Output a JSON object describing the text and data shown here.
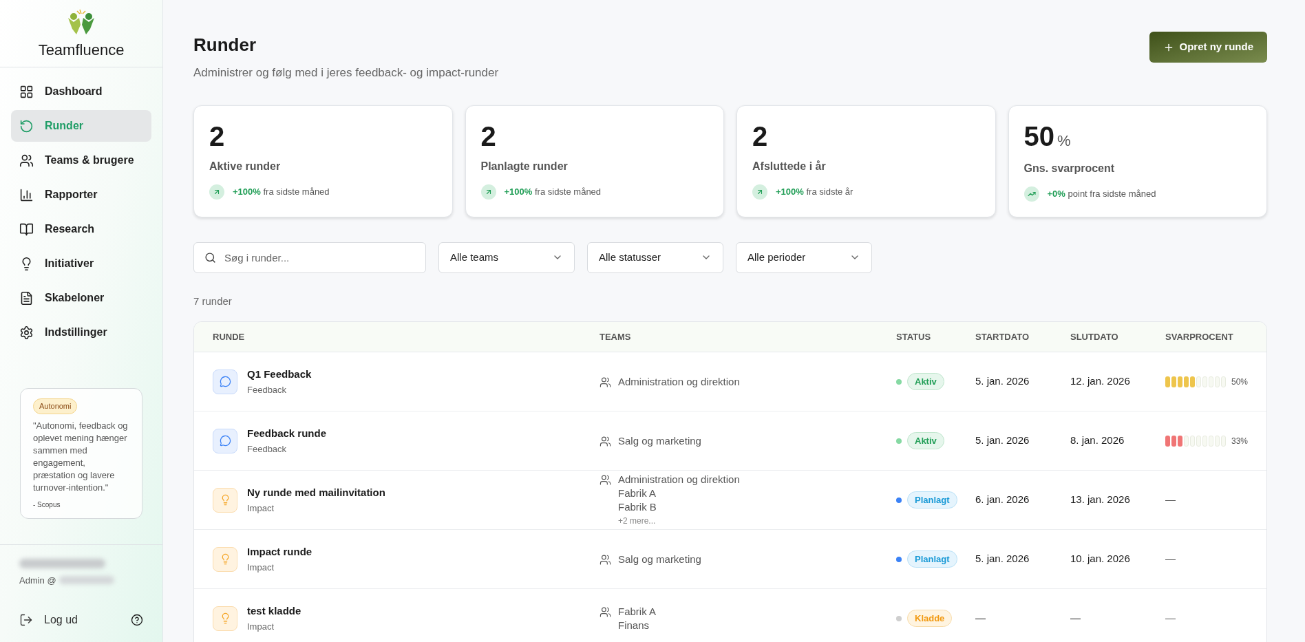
{
  "sidebar": {
    "brand": "Teamfluence",
    "items": [
      {
        "label": "Dashboard",
        "selected": false
      },
      {
        "label": "Runder",
        "selected": true
      },
      {
        "label": "Teams & brugere",
        "selected": false
      },
      {
        "label": "Rapporter",
        "selected": false
      },
      {
        "label": "Research",
        "selected": false
      },
      {
        "label": "Initiativer",
        "selected": false
      },
      {
        "label": "Skabeloner",
        "selected": false
      },
      {
        "label": "Indstillinger",
        "selected": false
      }
    ],
    "quote": {
      "tag": "Autonomi",
      "text": "\"Autonomi, feedback og oplevet mening hænger sammen med engagement, præstation og lavere turnover-intention.\"",
      "source": "- Scopus"
    },
    "user": {
      "role": "Admin @"
    },
    "logout": "Log ud"
  },
  "header": {
    "title": "Runder",
    "subtitle": "Administrer og følg med i jeres feedback- og impact-runder",
    "button": "Opret ny runde"
  },
  "stats": [
    {
      "value": "2",
      "label": "Aktive runder",
      "change": "+100%",
      "note": "fra sidste måned"
    },
    {
      "value": "2",
      "label": "Planlagte runder",
      "change": "+100%",
      "note": "fra sidste måned"
    },
    {
      "value": "2",
      "label": "Afsluttede i år",
      "change": "+100%",
      "note": "fra sidste år"
    },
    {
      "value": "50",
      "unit": "%",
      "label": "Gns. svarprocent",
      "change": "+0%",
      "note": "point fra sidste måned"
    }
  ],
  "filters": {
    "search": {
      "placeholder": "Søg i runder..."
    },
    "dropdowns": [
      "Alle teams",
      "Alle statusser",
      "Alle perioder"
    ]
  },
  "count": "7 runder",
  "table": {
    "columns": [
      "RUNDE",
      "TEAMS",
      "STATUS",
      "STARTDATO",
      "SLUTDATO",
      "SVARPROCENT"
    ],
    "rows": [
      {
        "name": "Q1 Feedback",
        "type": "Feedback",
        "kind": "feedback",
        "teams": [
          "Administration og direktion"
        ],
        "status": {
          "label": "Aktiv",
          "kind": "active",
          "color": "#86d9a3"
        },
        "start": "5. jan. 2026",
        "end": "12. jan. 2026",
        "response": {
          "level": 0.5,
          "color": "#eec54c",
          "reading": "50%"
        }
      },
      {
        "name": "Feedback runde",
        "type": "Feedback",
        "kind": "feedback",
        "teams": [
          "Salg og marketing"
        ],
        "status": {
          "label": "Aktiv",
          "kind": "active",
          "color": "#86d9a3"
        },
        "start": "5. jan. 2026",
        "end": "8. jan. 2026",
        "response": {
          "level": 0.33,
          "color": "#f07575",
          "reading": "33%"
        }
      },
      {
        "name": "Ny runde med mailinvitation",
        "type": "Impact",
        "kind": "impact",
        "teams": [
          "Administration og direktion",
          "Fabrik A",
          "Fabrik B"
        ],
        "more": "+2 mere...",
        "status": {
          "label": "Planlagt",
          "kind": "planned",
          "color": "#3b82f6"
        },
        "start": "6. jan. 2026",
        "end": "13. jan. 2026",
        "response": {
          "empty": "—"
        }
      },
      {
        "name": "Impact runde",
        "type": "Impact",
        "kind": "impact",
        "teams": [
          "Salg og marketing"
        ],
        "status": {
          "label": "Planlagt",
          "kind": "planned",
          "color": "#3b82f6"
        },
        "start": "5. jan. 2026",
        "end": "10. jan. 2026",
        "response": {
          "empty": "—"
        }
      },
      {
        "name": "test kladde",
        "type": "Impact",
        "kind": "impact",
        "teams": [
          "Fabrik A",
          "Finans"
        ],
        "status": {
          "label": "Kladde",
          "kind": "draft",
          "color": "#cfcfcf"
        },
        "start": "—",
        "end": "—",
        "response": {
          "empty": "—"
        }
      }
    ]
  }
}
